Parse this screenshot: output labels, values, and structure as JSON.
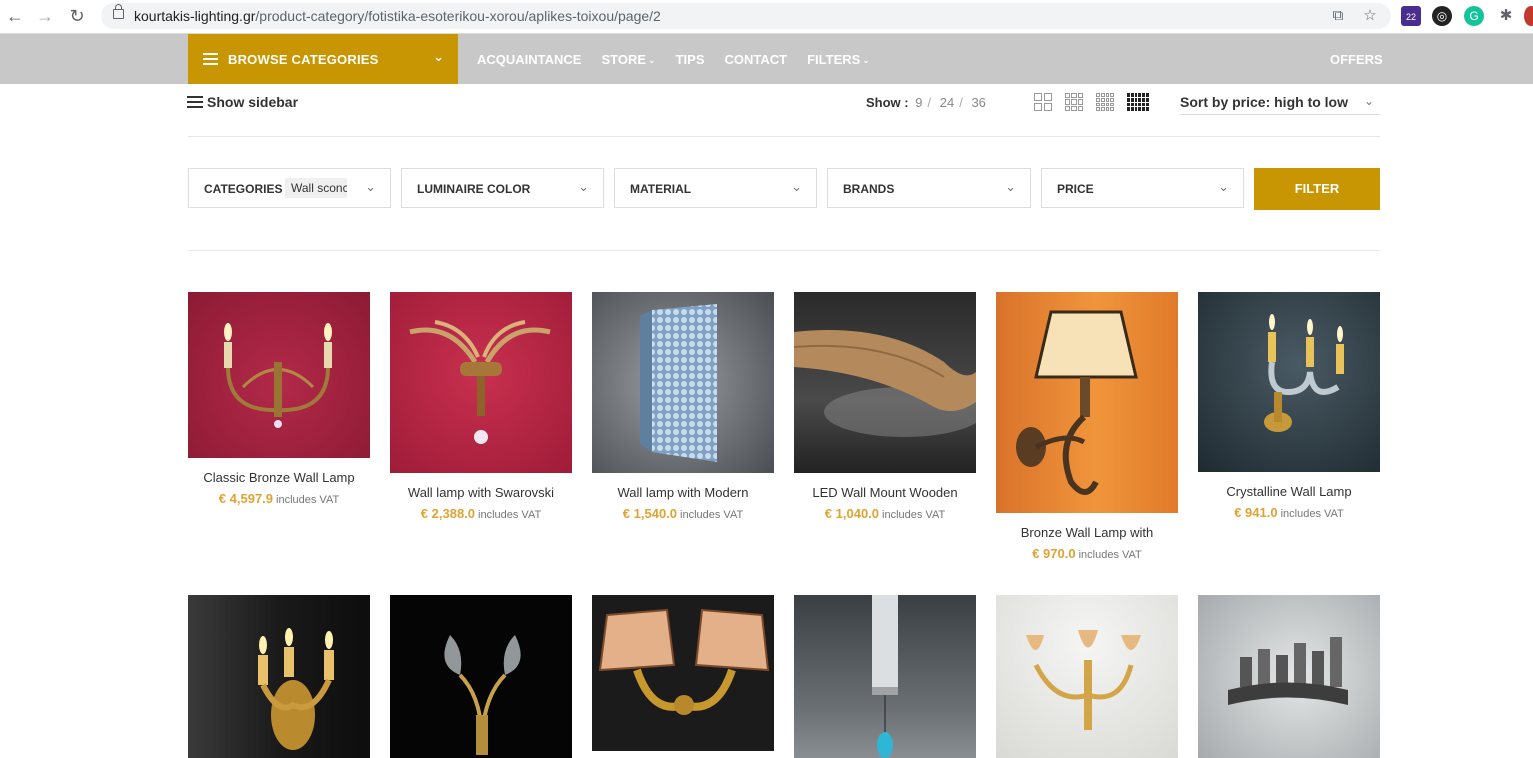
{
  "browser": {
    "url_host": "kourtakis-lighting.gr",
    "url_path": "/product-category/fotistika-esoterikou-xorou/aplikes-toixou/page/2",
    "ext_badge": "22"
  },
  "header": {
    "browse_label": "BROWSE CATEGORIES",
    "nav": [
      {
        "label": "ACQUAINTANCE",
        "dropdown": false
      },
      {
        "label": "STORE",
        "dropdown": true
      },
      {
        "label": "TIPS",
        "dropdown": false
      },
      {
        "label": "CONTACT",
        "dropdown": false
      },
      {
        "label": "FILTERS",
        "dropdown": true
      }
    ],
    "offers_label": "OFFERS"
  },
  "toolbar": {
    "show_sidebar_label": "Show sidebar",
    "show_label": "Show",
    "show_options": [
      "9",
      "24",
      "36"
    ],
    "sort_label": "Sort by price: high to low",
    "active_grid_columns": 6
  },
  "filters": {
    "items": [
      {
        "label": "CATEGORIES",
        "value": "Wall sconces"
      },
      {
        "label": "LUMINAIRE COLOR",
        "value": ""
      },
      {
        "label": "MATERIAL",
        "value": ""
      },
      {
        "label": "BRANDS",
        "value": ""
      },
      {
        "label": "PRICE",
        "value": ""
      }
    ],
    "button_label": "FILTER"
  },
  "products": [
    {
      "name": "Classic Bronze Wall Lamp",
      "price": "€ 4,597.9",
      "vat": "includes VAT"
    },
    {
      "name": "Wall lamp with Swarovski",
      "price": "€ 2,388.0",
      "vat": "includes VAT"
    },
    {
      "name": "Wall lamp with Modern",
      "price": "€ 1,540.0",
      "vat": "includes VAT"
    },
    {
      "name": "LED Wall Mount Wooden",
      "price": "€ 1,040.0",
      "vat": "includes VAT"
    },
    {
      "name": "Bronze Wall Lamp with",
      "price": "€ 970.0",
      "vat": "includes VAT"
    },
    {
      "name": "Crystalline Wall Lamp",
      "price": "€ 941.0",
      "vat": "includes VAT"
    }
  ],
  "colors": {
    "accent": "#c89503",
    "price": "#e0a331",
    "header_bg": "#c8c8c8"
  }
}
